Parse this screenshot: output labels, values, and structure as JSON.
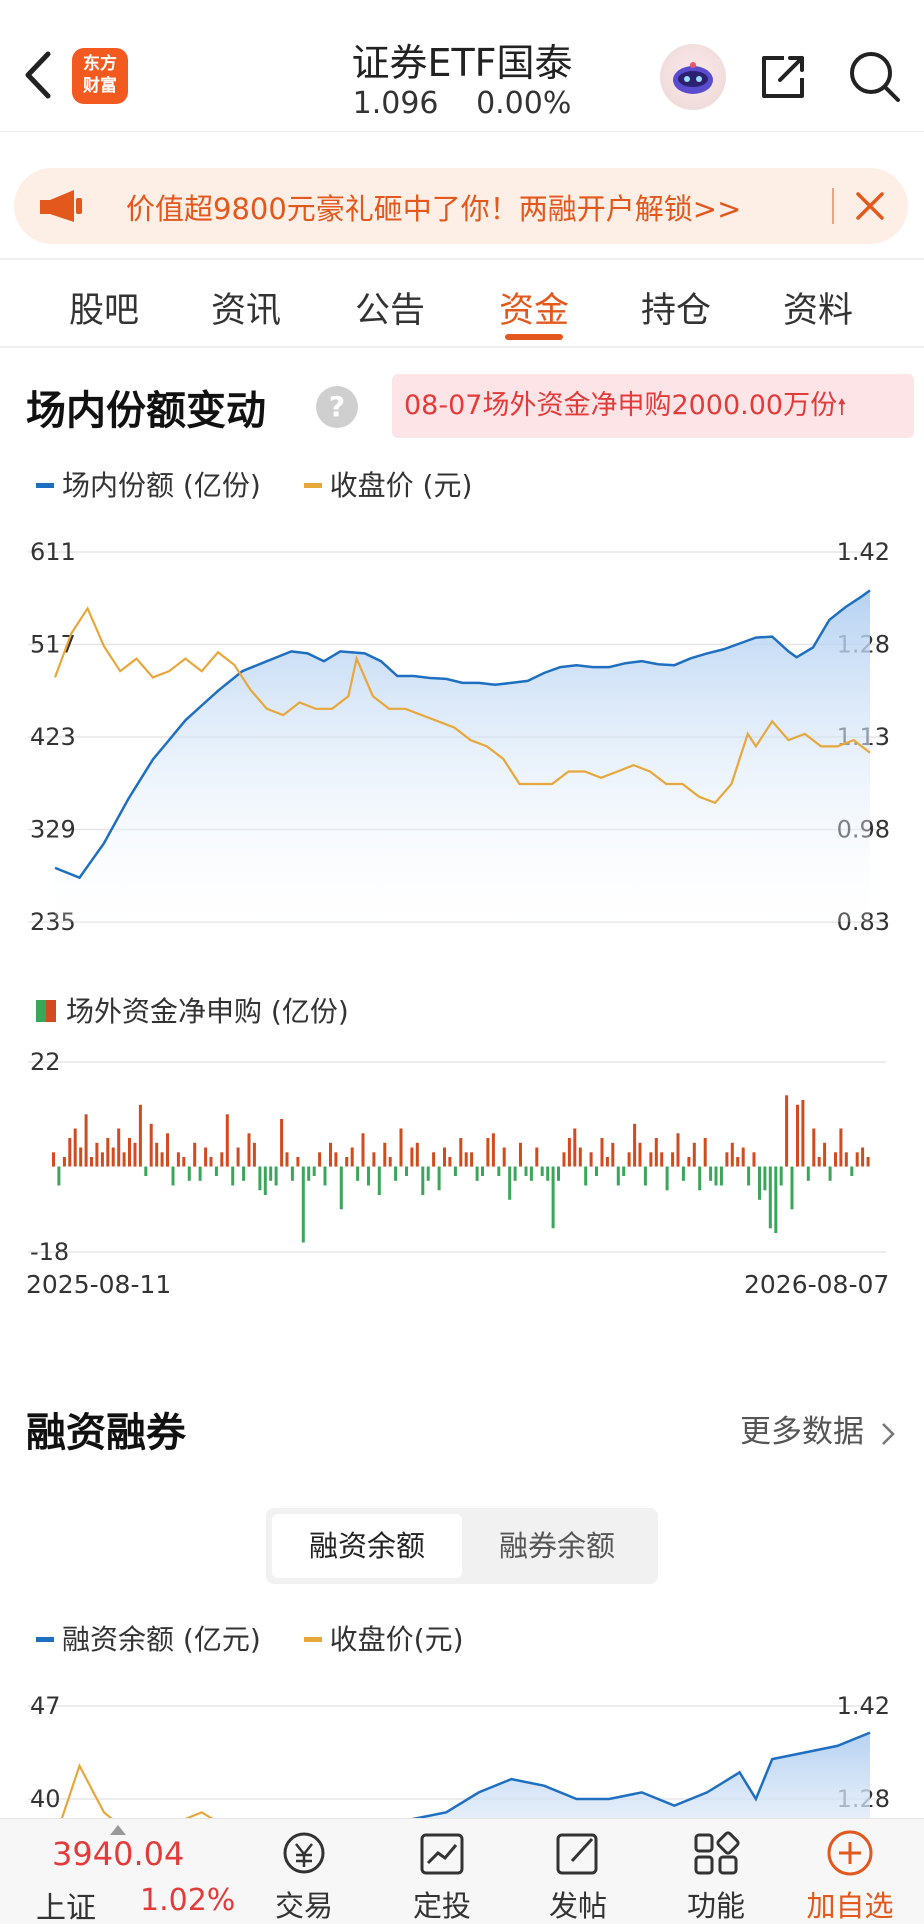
{
  "header": {
    "logo_text": "东方财富",
    "title": "证券ETF国泰",
    "price": "1.096",
    "change_pct": "0.00%"
  },
  "banner": {
    "text": "价值超9800元豪礼砸中了你！两融开户解锁>>"
  },
  "tabs": [
    {
      "label": "股吧"
    },
    {
      "label": "资讯"
    },
    {
      "label": "公告"
    },
    {
      "label": "资金"
    },
    {
      "label": "持仓"
    },
    {
      "label": "资料"
    }
  ],
  "active_tab": "资金",
  "share_section": {
    "title": "场内份额变动",
    "net_subscription_note": "08-07场外资金净申购2000.00万份",
    "legend": {
      "shares": "场内份额 (亿份)",
      "close": "收盘价 (元)"
    },
    "left_axis": [
      "611",
      "517",
      "423",
      "329",
      "235"
    ],
    "right_axis": [
      "1.42",
      "1.28",
      "1.13",
      "0.98",
      "0.83"
    ],
    "net_legend": "场外资金净申购 (亿份)",
    "net_axis": [
      "22",
      "-18"
    ],
    "start_date": "2025-08-11",
    "end_date": "2026-08-07"
  },
  "margin_section": {
    "title": "融资融券",
    "more": "更多数据",
    "seg_buttons": [
      "融资余额",
      "融券余额"
    ],
    "legend": {
      "financing": "融资余额 (亿元)",
      "close": "收盘价(元)"
    },
    "left_axis": [
      "47",
      "40"
    ],
    "right_axis": [
      "1.42",
      "1.28"
    ]
  },
  "bottom_bar": {
    "index_value": "3940.04",
    "index_name": "上证",
    "index_pct": "1.02%",
    "nav": [
      {
        "label": "交易"
      },
      {
        "label": "定投"
      },
      {
        "label": "发帖"
      },
      {
        "label": "功能"
      },
      {
        "label": "加自选"
      }
    ]
  },
  "colors": {
    "accent": "#e2581d",
    "up": "#e33a3a",
    "share_line": "#1f6fc1",
    "price_line": "#e8a73a",
    "bar_up": "#d24a1e",
    "bar_down": "#3aa65a"
  },
  "chart_data": [
    {
      "type": "line",
      "title": "场内份额变动",
      "series": [
        {
          "name": "场内份额 (亿份)",
          "axis": "left",
          "points": [
            [
              0,
              290
            ],
            [
              3,
              280
            ],
            [
              6,
              315
            ],
            [
              9,
              360
            ],
            [
              12,
              400
            ],
            [
              14,
              420
            ],
            [
              16,
              440
            ],
            [
              18,
              455
            ],
            [
              20,
              470
            ],
            [
              23,
              490
            ],
            [
              26,
              500
            ],
            [
              29,
              510
            ],
            [
              31,
              508
            ],
            [
              33,
              500
            ],
            [
              35,
              510
            ],
            [
              38,
              508
            ],
            [
              40,
              500
            ],
            [
              42,
              485
            ],
            [
              44,
              485
            ],
            [
              46,
              483
            ],
            [
              48,
              482
            ],
            [
              50,
              478
            ],
            [
              52,
              478
            ],
            [
              54,
              476
            ],
            [
              56,
              478
            ],
            [
              58,
              480
            ],
            [
              60,
              488
            ],
            [
              62,
              494
            ],
            [
              64,
              496
            ],
            [
              66,
              494
            ],
            [
              68,
              494
            ],
            [
              70,
              498
            ],
            [
              72,
              500
            ],
            [
              74,
              497
            ],
            [
              76,
              496
            ],
            [
              78,
              503
            ],
            [
              80,
              508
            ],
            [
              82,
              512
            ],
            [
              84,
              518
            ],
            [
              86,
              524
            ],
            [
              88,
              525
            ],
            [
              90,
              510
            ],
            [
              91,
              504
            ],
            [
              93,
              514
            ],
            [
              95,
              542
            ],
            [
              97,
              555
            ],
            [
              99,
              566
            ],
            [
              100,
              572
            ]
          ],
          "range": [
            235,
            611
          ]
        },
        {
          "name": "收盘价 (元)",
          "axis": "right",
          "points": [
            [
              0,
              1.22
            ],
            [
              2,
              1.29
            ],
            [
              4,
              1.33
            ],
            [
              6,
              1.27
            ],
            [
              8,
              1.23
            ],
            [
              10,
              1.25
            ],
            [
              12,
              1.22
            ],
            [
              14,
              1.23
            ],
            [
              16,
              1.25
            ],
            [
              18,
              1.23
            ],
            [
              20,
              1.26
            ],
            [
              22,
              1.24
            ],
            [
              24,
              1.2
            ],
            [
              26,
              1.17
            ],
            [
              28,
              1.16
            ],
            [
              30,
              1.18
            ],
            [
              32,
              1.17
            ],
            [
              34,
              1.17
            ],
            [
              36,
              1.19
            ],
            [
              37,
              1.25
            ],
            [
              39,
              1.19
            ],
            [
              41,
              1.17
            ],
            [
              43,
              1.17
            ],
            [
              45,
              1.16
            ],
            [
              47,
              1.15
            ],
            [
              49,
              1.14
            ],
            [
              51,
              1.12
            ],
            [
              53,
              1.11
            ],
            [
              55,
              1.09
            ],
            [
              57,
              1.05
            ],
            [
              59,
              1.05
            ],
            [
              61,
              1.05
            ],
            [
              63,
              1.07
            ],
            [
              65,
              1.07
            ],
            [
              67,
              1.06
            ],
            [
              69,
              1.07
            ],
            [
              71,
              1.08
            ],
            [
              73,
              1.07
            ],
            [
              75,
              1.05
            ],
            [
              77,
              1.05
            ],
            [
              79,
              1.03
            ],
            [
              81,
              1.02
            ],
            [
              83,
              1.05
            ],
            [
              84,
              1.09
            ],
            [
              85,
              1.13
            ],
            [
              86,
              1.11
            ],
            [
              88,
              1.15
            ],
            [
              90,
              1.12
            ],
            [
              92,
              1.13
            ],
            [
              94,
              1.11
            ],
            [
              96,
              1.11
            ],
            [
              98,
              1.12
            ],
            [
              100,
              1.1
            ]
          ],
          "range": [
            0.83,
            1.42
          ]
        }
      ],
      "x_range": [
        "2025-08-11",
        "2026-08-07"
      ],
      "grid": true
    },
    {
      "type": "bar",
      "title": "场外资金净申购 (亿份)",
      "ylim": [
        -18,
        22
      ],
      "values": [
        3,
        -4,
        2,
        6,
        8,
        4,
        11,
        2,
        5,
        3,
        6,
        4,
        8,
        3,
        6,
        5,
        13,
        -2,
        9,
        5,
        3,
        7,
        -4,
        3,
        2,
        -3,
        5,
        -3,
        4,
        2,
        -2,
        3,
        11,
        -4,
        4,
        -3,
        7,
        5,
        -5,
        -6,
        -3,
        -4,
        10,
        3,
        -3,
        2,
        -16,
        -3,
        -2,
        3,
        -4,
        5,
        3,
        -9,
        2,
        4,
        -3,
        7,
        -4,
        3,
        -6,
        5,
        2,
        -3,
        8,
        -2,
        4,
        5,
        -6,
        -3,
        3,
        -5,
        4,
        2,
        -2,
        6,
        3,
        3,
        -3,
        -2,
        6,
        7,
        -2,
        4,
        -7,
        -3,
        5,
        -2,
        -3,
        4,
        -2,
        -3,
        -13,
        -3,
        3,
        6,
        8,
        4,
        -4,
        3,
        -2,
        6,
        2,
        5,
        -4,
        -2,
        3,
        9,
        5,
        -4,
        3,
        6,
        3,
        -5,
        3,
        7,
        -3,
        2,
        5,
        -5,
        6,
        -3,
        -4,
        -4,
        3,
        5,
        2,
        4,
        -4,
        3,
        -7,
        -5,
        -13,
        -14,
        -4,
        15,
        -9,
        13,
        14,
        -3,
        8,
        2,
        5,
        -3,
        3,
        8,
        3,
        -2,
        3,
        4,
        2
      ]
    },
    {
      "type": "line",
      "title": "融资融券",
      "series": [
        {
          "name": "融资余额 (亿元)",
          "axis": "left",
          "points": [
            [
              40,
              38
            ],
            [
              44,
              38.5
            ],
            [
              48,
              39
            ],
            [
              52,
              40.5
            ],
            [
              56,
              41.5
            ],
            [
              60,
              41
            ],
            [
              64,
              40
            ],
            [
              68,
              40
            ],
            [
              72,
              40.5
            ],
            [
              76,
              39.5
            ],
            [
              80,
              40.5
            ],
            [
              84,
              42
            ],
            [
              86,
              40
            ],
            [
              88,
              43
            ],
            [
              92,
              43.5
            ],
            [
              96,
              44
            ],
            [
              100,
              45
            ]
          ],
          "range": [
            33,
            47
          ]
        },
        {
          "name": "收盘价(元)",
          "axis": "right",
          "points": [
            [
              0,
              1.22
            ],
            [
              3,
              1.33
            ],
            [
              6,
              1.26
            ],
            [
              10,
              1.22
            ],
            [
              14,
              1.24
            ],
            [
              18,
              1.26
            ],
            [
              22,
              1.23
            ],
            [
              26,
              1.2
            ],
            [
              30,
              1.18
            ],
            [
              34,
              1.17
            ],
            [
              38,
              1.19
            ]
          ],
          "range": [
            0.83,
            1.42
          ]
        }
      ]
    }
  ]
}
